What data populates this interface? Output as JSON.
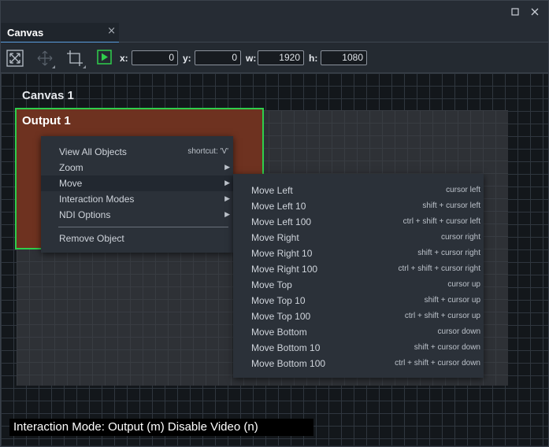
{
  "window": {
    "maximize_icon": "maximize-icon",
    "close_icon": "close-icon"
  },
  "tab": {
    "label": "Canvas",
    "close_glyph": "×"
  },
  "toolbar": {
    "x_label": "x:",
    "x_value": "0",
    "y_label": "y:",
    "y_value": "0",
    "w_label": "w:",
    "w_value": "1920",
    "h_label": "h:",
    "h_value": "1080",
    "icons": [
      "fit-view-icon",
      "move-tool-icon",
      "crop-tool-icon",
      "play-icon"
    ]
  },
  "canvas": {
    "title": "Canvas 1",
    "output_title": "Output 1"
  },
  "context_menu": {
    "items": [
      {
        "label": "View All Objects",
        "shortcut": "shortcut: 'V'"
      },
      {
        "label": "Zoom",
        "submenu": true
      },
      {
        "label": "Move",
        "submenu": true,
        "highlighted": true
      },
      {
        "label": "Interaction Modes",
        "submenu": true
      },
      {
        "label": "NDI Options",
        "submenu": true
      },
      {
        "label": "Remove Object"
      }
    ]
  },
  "move_menu": {
    "items": [
      {
        "label": "Move Left",
        "shortcut": "cursor left"
      },
      {
        "label": "Move Left 10",
        "shortcut": "shift + cursor left"
      },
      {
        "label": "Move Left 100",
        "shortcut": "ctrl + shift + cursor left"
      },
      {
        "label": "Move Right",
        "shortcut": "cursor right"
      },
      {
        "label": "Move Right 10",
        "shortcut": "shift + cursor right"
      },
      {
        "label": "Move Right 100",
        "shortcut": "ctrl + shift + cursor right"
      },
      {
        "label": "Move Top",
        "shortcut": "cursor up"
      },
      {
        "label": "Move Top 10",
        "shortcut": "shift + cursor up"
      },
      {
        "label": "Move Top 100",
        "shortcut": "ctrl + shift + cursor up"
      },
      {
        "label": "Move Bottom",
        "shortcut": "cursor down"
      },
      {
        "label": "Move Bottom 10",
        "shortcut": "shift + cursor down"
      },
      {
        "label": "Move Bottom 100",
        "shortcut": "ctrl + shift + cursor down"
      }
    ]
  },
  "status": {
    "text": "Interaction Mode: Output (m) Disable Video (n)"
  },
  "colors": {
    "output_fill": "#6e3220",
    "output_border": "#2fcf4c",
    "play_accent": "#2fcf4c",
    "tab_accent": "#5a9de0"
  }
}
